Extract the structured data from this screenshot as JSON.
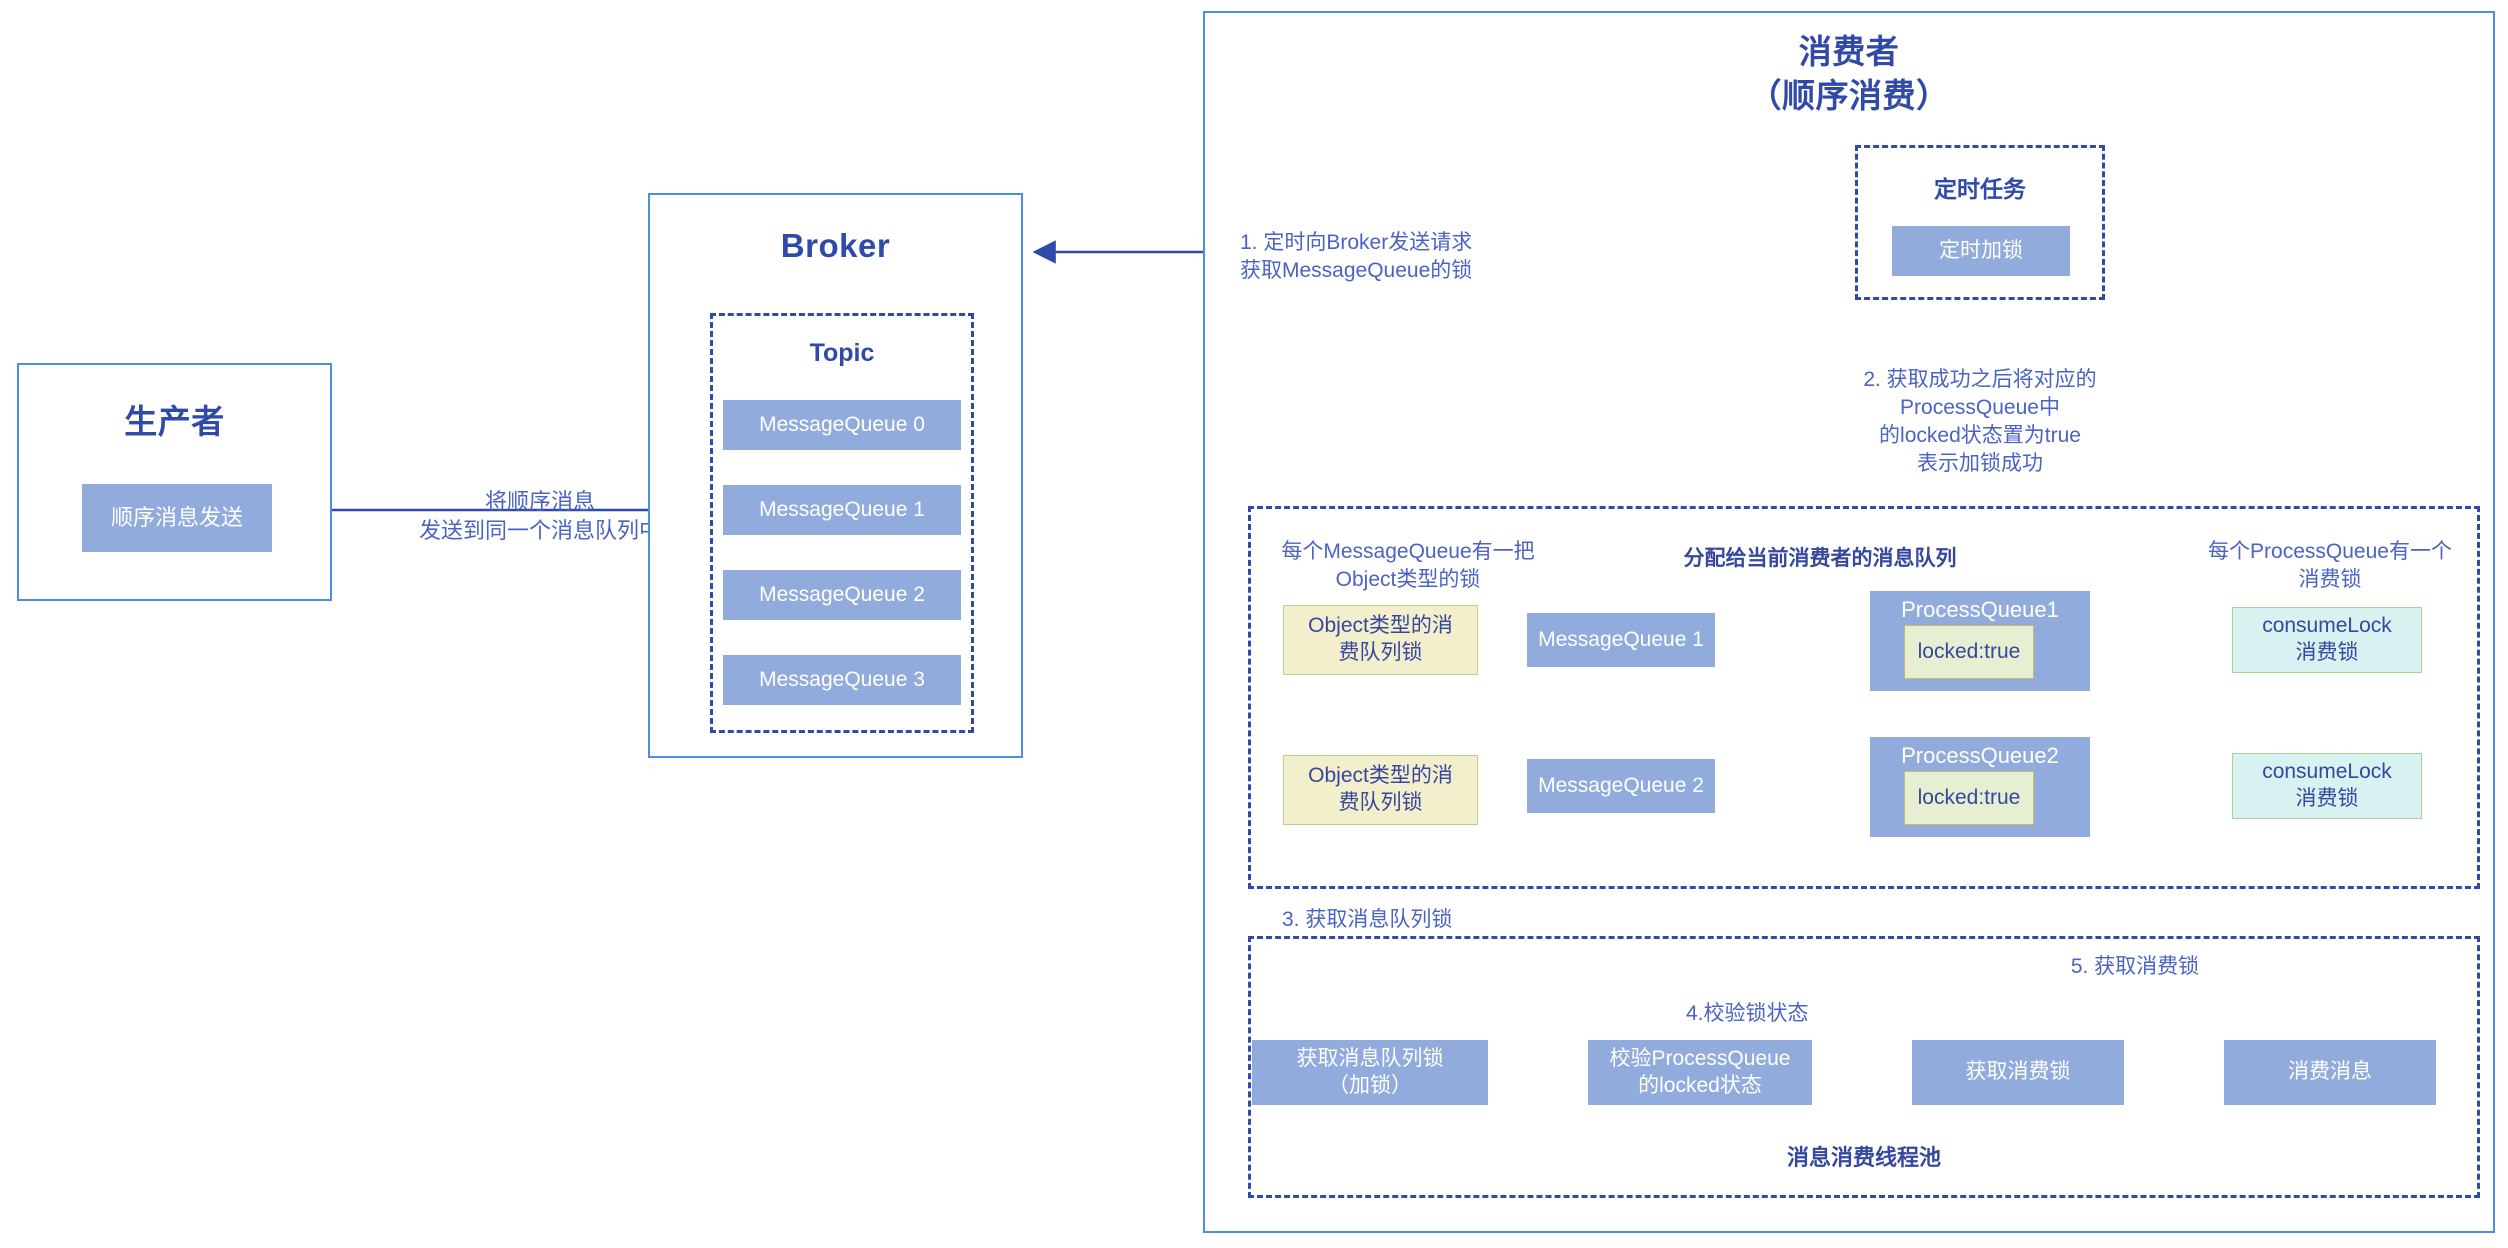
{
  "producer": {
    "title": "生产者",
    "send_button": "顺序消息发送"
  },
  "broker": {
    "title": "Broker",
    "topic_title": "Topic",
    "queues": [
      "MessageQueue 0",
      "MessageQueue 1",
      "MessageQueue 2",
      "MessageQueue 3"
    ]
  },
  "consumer": {
    "title_line1": "消费者",
    "title_line2": "（顺序消费）",
    "scheduled_task": {
      "title": "定时任务",
      "button": "定时加锁"
    },
    "queue_area": {
      "left_caption": "每个MessageQueue有一把\nObject类型的锁",
      "center_caption": "分配给当前消费者的消息队列",
      "right_caption": "每个ProcessQueue有一个\n消费锁",
      "rows": [
        {
          "object_lock": "Object类型的消\n费队列锁",
          "message_queue": "MessageQueue 1",
          "process_queue_title": "ProcessQueue1",
          "locked_state": "locked:true",
          "consume_lock": "consumeLock\n消费锁"
        },
        {
          "object_lock": "Object类型的消\n费队列锁",
          "message_queue": "MessageQueue 2",
          "process_queue_title": "ProcessQueue2",
          "locked_state": "locked:true",
          "consume_lock": "consumeLock\n消费锁"
        }
      ]
    },
    "thread_pool": {
      "caption": "消息消费线程池",
      "steps": [
        "获取消息队列锁\n（加锁）",
        "校验ProcessQueue\n的locked状态",
        "获取消费锁",
        "消费消息"
      ]
    }
  },
  "edge_labels": {
    "producer_to_broker": "将顺序消息\n发送到同一个消息队列中",
    "step1": "1. 定时向Broker发送请求\n获取MessageQueue的锁",
    "step2": "2. 获取成功之后将对应的\nProcessQueue中\n的locked状态置为true\n表示加锁成功",
    "step3": "3. 获取消息队列锁",
    "step4": "4.校验锁状态",
    "step5": "5. 获取消费锁"
  },
  "colors": {
    "outline_blue": "#4a90e2",
    "dash_blue": "#2f4aa8",
    "node_blue": "#92abdd",
    "node_yellow": "#f3eecb",
    "node_cyan": "#d7f2f1",
    "node_lime": "#e7efd3",
    "text_blue": "#2f4aa8",
    "label_blue": "#4a63c4"
  }
}
